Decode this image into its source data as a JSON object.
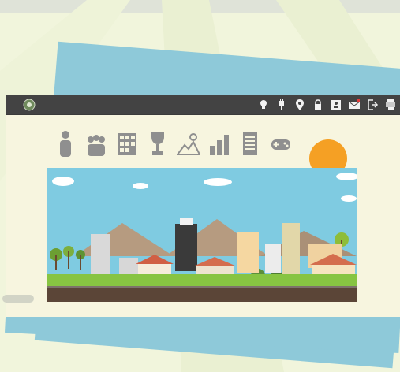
{
  "colors": {
    "background": "#f1f5dc",
    "navbar": "#434343",
    "icon_gray": "#8f8f8f",
    "blue_card": "#8ec9d9",
    "sun": "#f5a024",
    "sky": "#7fcbe1"
  },
  "navbar": {
    "logo": "globe-logo-icon",
    "icons": [
      "lightbulb-icon",
      "plug-icon",
      "map-pin-icon",
      "lock-icon",
      "contact-card-icon",
      "mail-icon",
      "logout-icon",
      "game-character-icon"
    ]
  },
  "toolbar": {
    "icons": [
      "person-icon",
      "group-icon",
      "calculator-icon",
      "trophy-icon",
      "landscape-icon",
      "bar-chart-icon",
      "document-icon",
      "gamepad-icon"
    ]
  },
  "scene": {
    "elements": [
      "city-illustration",
      "sun",
      "clouds",
      "mountains",
      "houses",
      "trees",
      "road"
    ]
  }
}
